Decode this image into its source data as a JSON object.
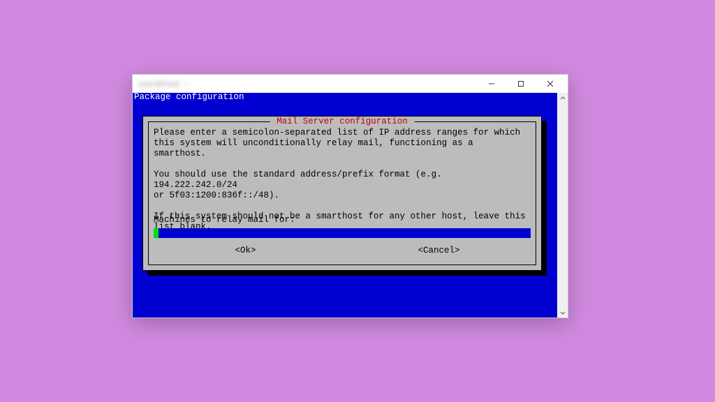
{
  "window": {
    "title": "user@host: ~"
  },
  "terminal": {
    "header_line": "Package configuration"
  },
  "dialog": {
    "title": " Mail Server configuration ",
    "body": "Please enter a semicolon-separated list of IP address ranges for which\nthis system will unconditionally relay mail, functioning as a smarthost.\n\nYou should use the standard address/prefix format (e.g. 194.222.242.0/24\nor 5f03:1200:836f::/48).\n\nIf this system should not be a smarthost for any other host, leave this\nlist blank.",
    "prompt": "Machines to relay mail for:",
    "input_value": "",
    "buttons": {
      "ok": "<Ok>",
      "cancel": "<Cancel>"
    }
  },
  "colors": {
    "desktop_bg": "#d18ae0",
    "terminal_bg": "#0000d0",
    "dialog_bg": "#bcbcbc",
    "dialog_title_fg": "#c40000",
    "cursor": "#00e000"
  }
}
